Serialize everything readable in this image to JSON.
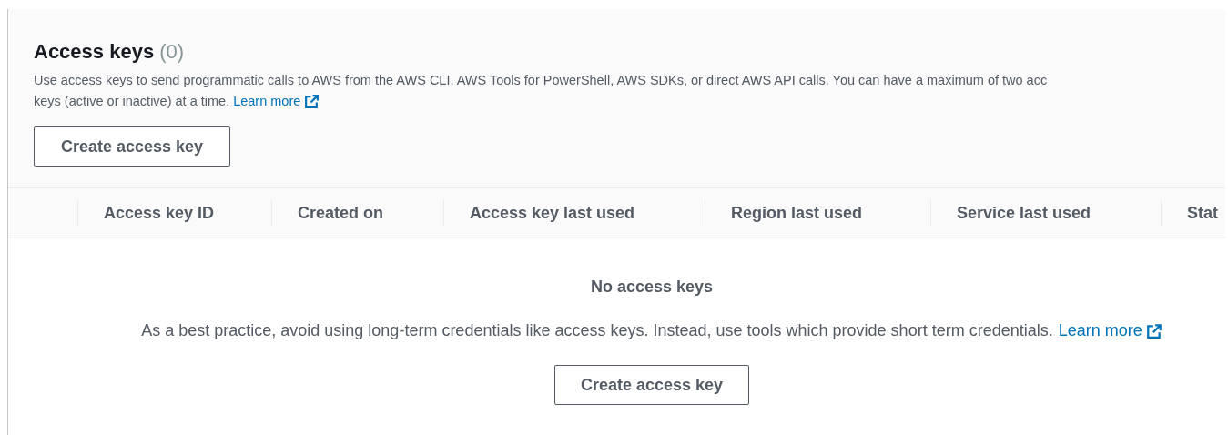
{
  "header": {
    "title": "Access keys",
    "count": "(0)",
    "description_lines": [
      "Use access keys to send programmatic calls to AWS from the AWS CLI, AWS Tools for PowerShell, AWS SDKs, or direct AWS API calls. You can have a maximum of two acc",
      "keys (active or inactive) at a time."
    ],
    "link": "Learn more",
    "button": "Create access key"
  },
  "table": {
    "columns": [
      "",
      "Access key ID",
      "Created on",
      "Access key last used",
      "Region last used",
      "Service last used",
      "Stat"
    ]
  },
  "empty_state": {
    "title": "No access keys",
    "message": "As a best practice, avoid using long-term credentials like access keys. Instead, use tools which provide short term credentials.",
    "link": "Learn more",
    "button": "Create access key"
  }
}
